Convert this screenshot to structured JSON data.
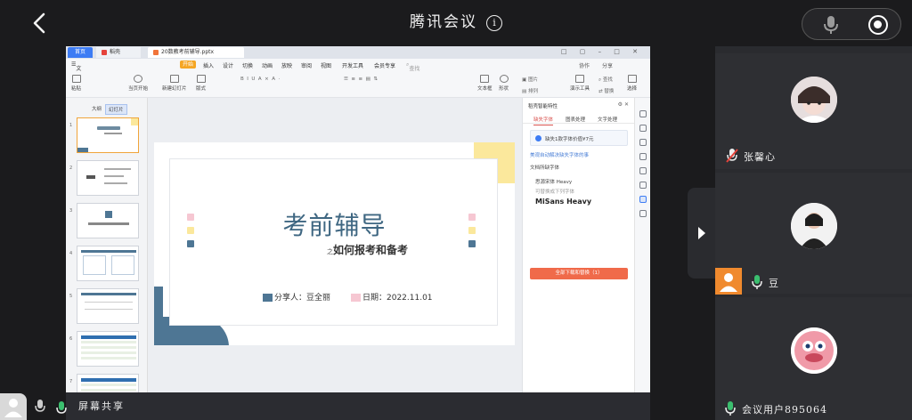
{
  "meeting": {
    "title": "腾讯会议",
    "share_label": "屏幕共享"
  },
  "app": {
    "tabs": [
      "首页",
      "稻壳",
      "20数教考前辅导.pptx"
    ],
    "menus": [
      "文件",
      "开始",
      "插入",
      "设计",
      "切换",
      "动画",
      "放映",
      "审阅",
      "视图",
      "开发工具",
      "会员专享"
    ],
    "active_menu": "开始",
    "search_placeholder": "查找命令、搜索模板",
    "right_menu": [
      "协作",
      "分享"
    ],
    "ribbon": [
      "粘贴",
      "当页开始",
      "新建幻灯片",
      "版式",
      "文本框",
      "形状",
      "图片",
      "排列",
      "演示工具",
      "查找",
      "替换",
      "选择"
    ],
    "left_tabs": [
      "大纲",
      "幻灯片"
    ],
    "slide_numbers": [
      "1",
      "2",
      "3",
      "4",
      "5",
      "6",
      "7"
    ]
  },
  "slide": {
    "title": "考前辅导",
    "subtitle_prefix": "之",
    "subtitle": "如何报考和备考",
    "presenter": "分享人：豆全丽",
    "date": "日期：2022.11.01"
  },
  "side_panel": {
    "header": "稻壳智能特性",
    "tabs": [
      "缺失字体",
      "图表处理",
      "文字处理"
    ],
    "notice": "缺失1款字体价值¥7元",
    "link": "美观自动解决缺失字体的事",
    "section": "文档所缺字体",
    "font1": "思源宋体 Heavy",
    "font1_hint": "可替换成下列字体",
    "font2": "MiSans Heavy",
    "button": "全部下载和替换（1）"
  },
  "participants": [
    {
      "name": "张馨心",
      "muted": true
    },
    {
      "name": "豆",
      "muted": false
    },
    {
      "name": "会议用户895064",
      "muted": false
    }
  ]
}
